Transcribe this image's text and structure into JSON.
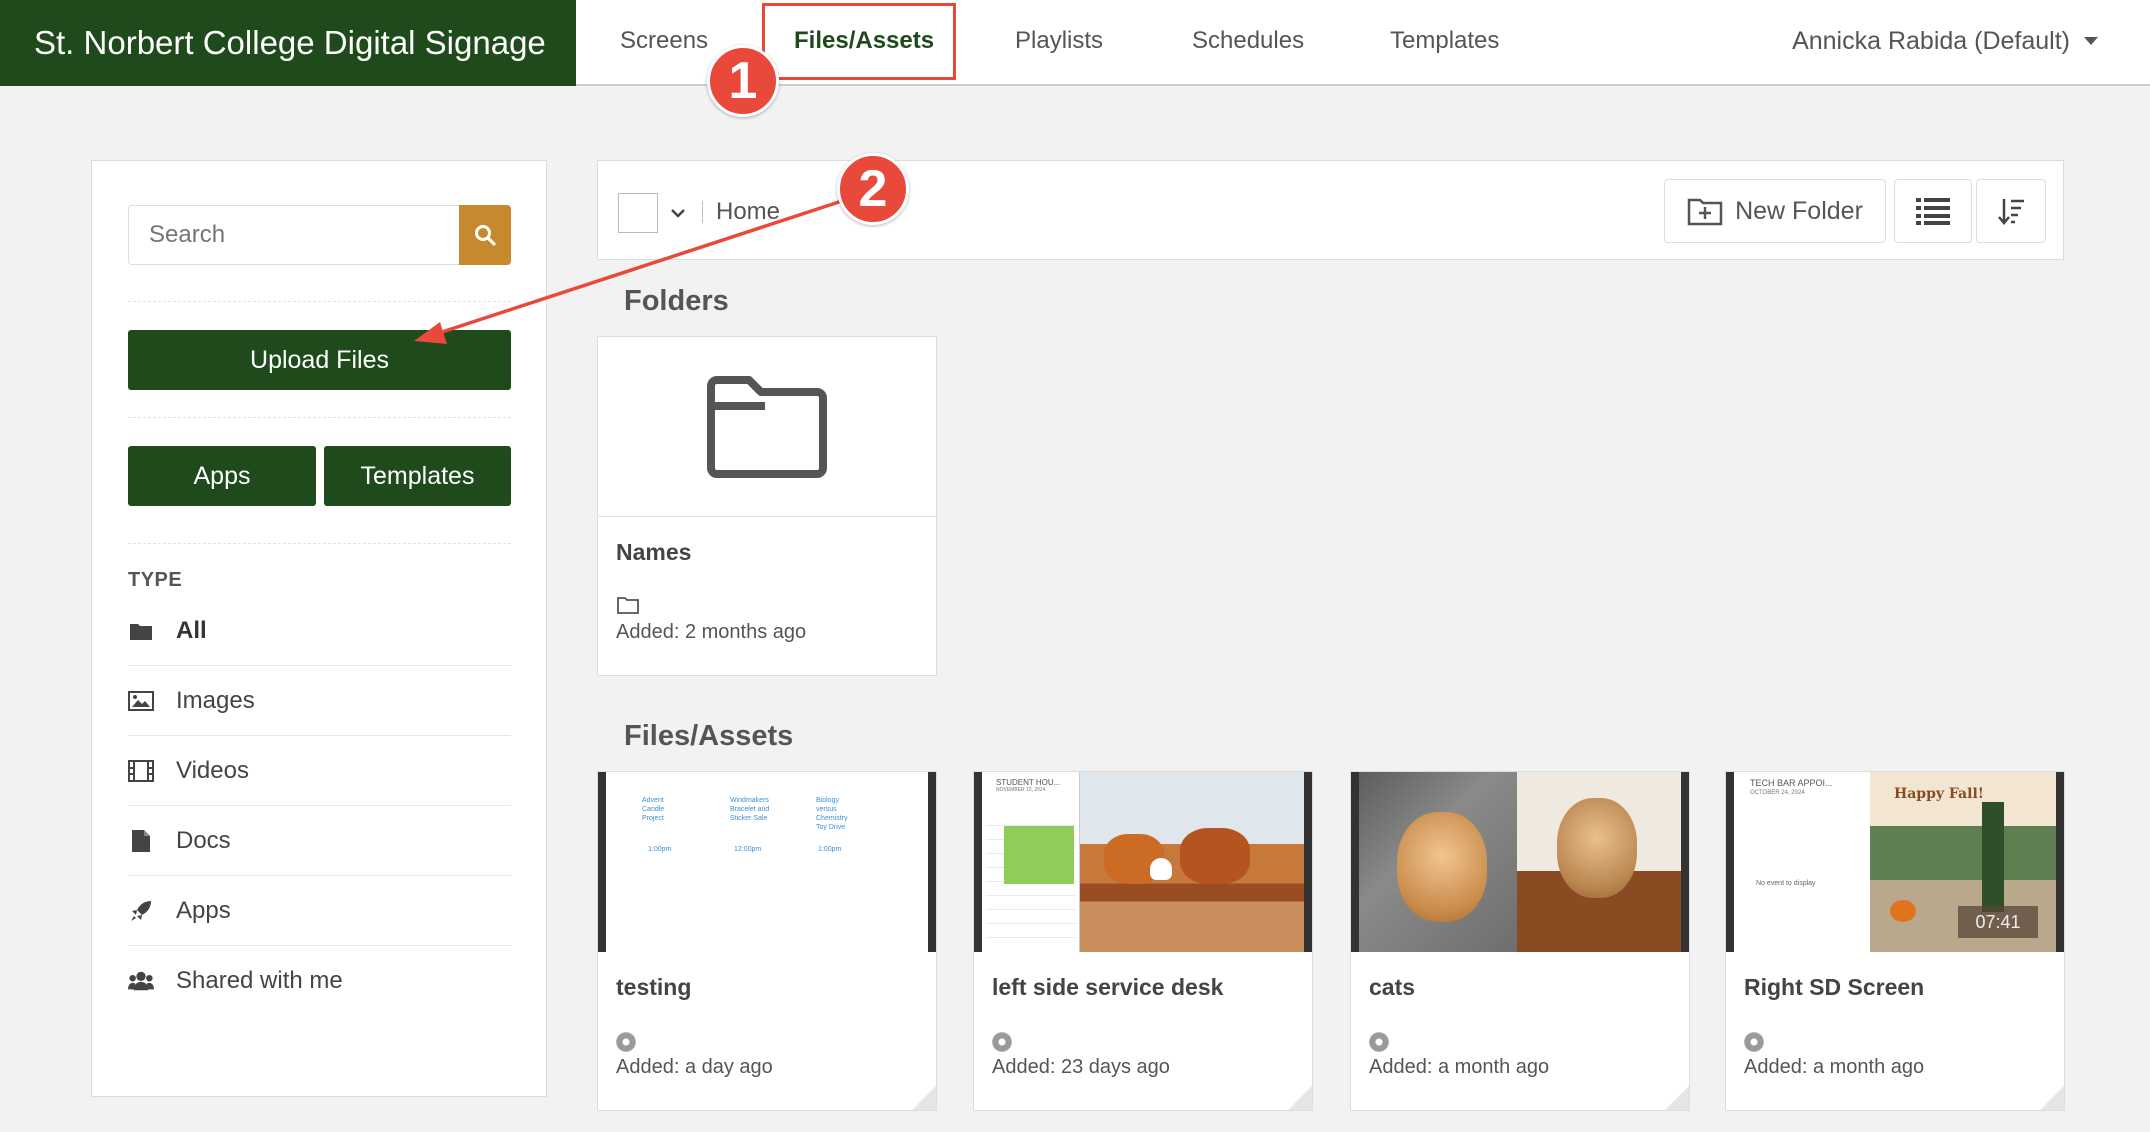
{
  "header": {
    "brand": "St. Norbert College Digital Signage",
    "nav": [
      {
        "label": "Screens"
      },
      {
        "label": "Files/Assets"
      },
      {
        "label": "Playlists"
      },
      {
        "label": "Schedules"
      },
      {
        "label": "Templates"
      }
    ],
    "user": "Annicka Rabida (Default)"
  },
  "annotations": {
    "step1": "1",
    "step2": "2",
    "accent": "#e8493a"
  },
  "sidebar": {
    "search_placeholder": "Search",
    "upload_label": "Upload Files",
    "apps_label": "Apps",
    "templates_label": "Templates",
    "type_title": "TYPE",
    "types": [
      {
        "label": "All",
        "icon": "folder-icon"
      },
      {
        "label": "Images",
        "icon": "image-icon"
      },
      {
        "label": "Videos",
        "icon": "film-icon"
      },
      {
        "label": "Docs",
        "icon": "document-icon"
      },
      {
        "label": "Apps",
        "icon": "rocket-icon"
      },
      {
        "label": "Shared with me",
        "icon": "users-icon"
      }
    ]
  },
  "toolbar": {
    "breadcrumb": "Home",
    "new_folder_label": "New Folder"
  },
  "folders": {
    "title": "Folders",
    "items": [
      {
        "name": "Names",
        "added": "Added: 2 months ago"
      }
    ]
  },
  "files": {
    "title": "Files/Assets",
    "items": [
      {
        "name": "testing",
        "added": "Added: a day ago"
      },
      {
        "name": "left side service desk",
        "added": "Added: 23 days ago"
      },
      {
        "name": "cats",
        "added": "Added: a month ago"
      },
      {
        "name": "Right SD Screen",
        "added": "Added: a month ago"
      }
    ],
    "thumb_text": {
      "testing": [
        "Advent Candle Project",
        "Windmakers Bracelet and Sticker Sale",
        "Biology versus Chemistry Toy Drive",
        "1:00pm",
        "12:00pm",
        "1:00pm"
      ],
      "left_header": [
        "STUDENT HOU...",
        "NOVEMBER 13, 2024"
      ],
      "right_header": [
        "TECH BAR APPOI...",
        "OCTOBER 24, 2024"
      ],
      "right_empty": "No event to display",
      "happy_fall": "Happy Fall!",
      "clock": "07:41"
    }
  },
  "colors": {
    "brand_green": "#1f4a1c",
    "search_btn": "#c8882d"
  }
}
